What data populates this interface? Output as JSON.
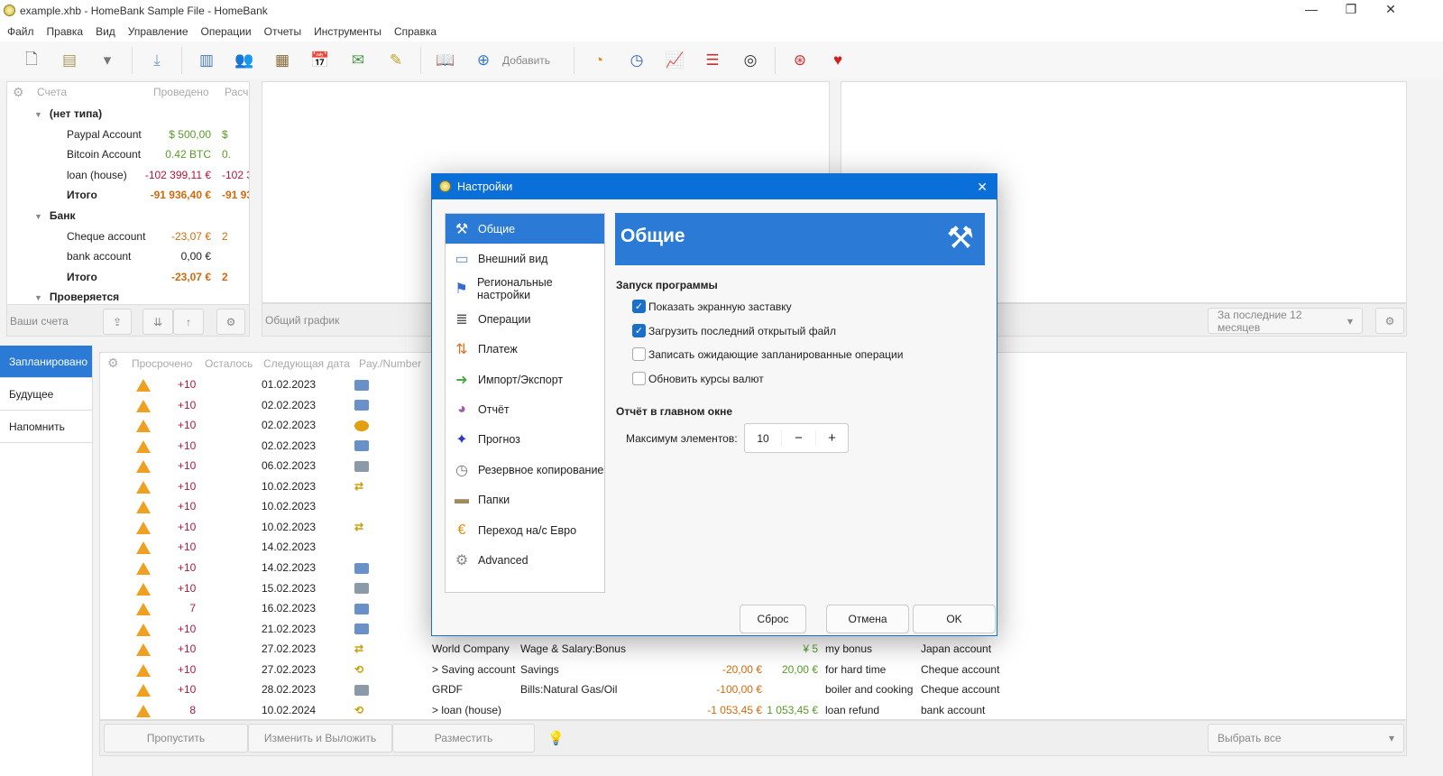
{
  "window": {
    "title": "example.xhb - HomeBank Sample File - HomeBank",
    "min": "—",
    "max": "❐",
    "close": "✕"
  },
  "menu": [
    "Файл",
    "Правка",
    "Вид",
    "Управление",
    "Операции",
    "Отчеты",
    "Инструменты",
    "Справка"
  ],
  "toolbar": {
    "add_label": "Добавить",
    "icons": [
      "new-file",
      "open-file",
      "dropdown",
      "save",
      "accounts",
      "payees",
      "categories",
      "scheduled",
      "email",
      "wizard",
      "book",
      "add",
      "pie-chart",
      "time-chart",
      "trend-chart",
      "budget",
      "vehicle",
      "help",
      "donate"
    ]
  },
  "accounts": {
    "headers": [
      "Счета",
      "Проведено",
      "Расч"
    ],
    "groups": [
      {
        "name": "(нет типа)",
        "items": [
          {
            "name": "Paypal Account",
            "cleared": "$ 500,00",
            "future": "$",
            "color": "green"
          },
          {
            "name": "Bitcoin Account",
            "cleared": "0.42 BTC",
            "future": "0.",
            "color": "green"
          },
          {
            "name": "loan (house)",
            "cleared": "-102 399,11 €",
            "future": "-102 39",
            "color": "red"
          }
        ],
        "total": {
          "label": "Итого",
          "cleared": "-91 936,40 €",
          "future": "-91 93"
        }
      },
      {
        "name": "Банк",
        "items": [
          {
            "name": "Cheque account",
            "cleared": "-23,07 €",
            "future": "2",
            "color": "orange"
          },
          {
            "name": "bank account",
            "cleared": "0,00 €",
            "future": "",
            "color": ""
          }
        ],
        "total": {
          "label": "Итого",
          "cleared": "-23,07 €",
          "future": "2"
        }
      },
      {
        "name": "Проверяется",
        "items": []
      }
    ],
    "footer": "Ваши счета"
  },
  "chart": {
    "footer": "Общий график",
    "period": "За последние 12 месяцев"
  },
  "tabs": [
    "Запланировано",
    "Будущее",
    "Напомнить"
  ],
  "scheduled": {
    "headers": [
      "Просрочено",
      "Осталось",
      "Следующая дата",
      "Pay./Number"
    ],
    "rows": [
      {
        "remain": "+10",
        "date": "01.02.2023",
        "pay": "card"
      },
      {
        "remain": "+10",
        "date": "02.02.2023",
        "pay": "card"
      },
      {
        "remain": "+10",
        "date": "02.02.2023",
        "pay": "coin"
      },
      {
        "remain": "+10",
        "date": "02.02.2023",
        "pay": "card"
      },
      {
        "remain": "+10",
        "date": "06.02.2023",
        "pay": "stack"
      },
      {
        "remain": "+10",
        "date": "10.02.2023",
        "pay": "transfer"
      },
      {
        "remain": "+10",
        "date": "10.02.2023",
        "pay": ""
      },
      {
        "remain": "+10",
        "date": "10.02.2023",
        "pay": "transfer"
      },
      {
        "remain": "+10",
        "date": "14.02.2023",
        "pay": ""
      },
      {
        "remain": "+10",
        "date": "14.02.2023",
        "pay": "card"
      },
      {
        "remain": "+10",
        "date": "15.02.2023",
        "pay": "stack"
      },
      {
        "remain": "7",
        "date": "16.02.2023",
        "pay": "card"
      },
      {
        "remain": "+10",
        "date": "21.02.2023",
        "pay": "card"
      },
      {
        "remain": "+10",
        "date": "27.02.2023",
        "pay": "transfer",
        "payee": "World Company",
        "category": "Wage & Salary:Bonus",
        "expense": "",
        "income": "¥ 5",
        "memo": "my bonus",
        "account": "Japan account"
      },
      {
        "remain": "+10",
        "date": "27.02.2023",
        "pay": "recycle",
        "payee": "> Saving account",
        "category": "Savings",
        "expense": "-20,00 €",
        "income": "20,00 €",
        "memo": "for hard time",
        "account": "Cheque account"
      },
      {
        "remain": "+10",
        "date": "28.02.2023",
        "pay": "stack",
        "payee": "GRDF",
        "category": "Bills:Natural Gas/Oil",
        "expense": "-100,00 €",
        "income": "",
        "memo": "boiler and cooking",
        "account": "Cheque account"
      },
      {
        "remain": "8",
        "date": "10.02.2024",
        "pay": "recycle",
        "payee": "> loan (house)",
        "category": "",
        "expense": "-1 053,45 €",
        "income": "1 053,45 €",
        "memo": "loan refund",
        "account": "bank account"
      }
    ],
    "buttons": [
      "Пропустить",
      "Изменить и Выложить",
      "Разместить"
    ],
    "select_all": "Выбрать все"
  },
  "dialog": {
    "title": "Настройки",
    "nav": [
      "Общие",
      "Внешний вид",
      "Региональные настройки",
      "Операции",
      "Платеж",
      "Импорт/Экспорт",
      "Отчёт",
      "Прогноз",
      "Резервное копирование",
      "Папки",
      "Переход на/с Евро",
      "Advanced"
    ],
    "heading": "Общие",
    "section1": "Запуск программы",
    "options": [
      {
        "label": "Показать экранную заставку",
        "checked": true
      },
      {
        "label": "Загрузить последний открытый файл",
        "checked": true
      },
      {
        "label": "Записать ожидающие запланированные операции",
        "checked": false
      },
      {
        "label": "Обновить курсы валют",
        "checked": false
      }
    ],
    "section2": "Отчёт в главном окне",
    "max_label": "Максимум элементов:",
    "max_value": "10",
    "minus": "−",
    "plus": "+",
    "buttons": {
      "reset": "Сброс",
      "cancel": "Отмена",
      "ok": "OK"
    }
  },
  "colors": {
    "accent": "#2a7ad6",
    "titlebar": "#0a6fd8",
    "negative": "#b0183a",
    "positive": "#5a9a2a",
    "warning": "#f0a020"
  }
}
